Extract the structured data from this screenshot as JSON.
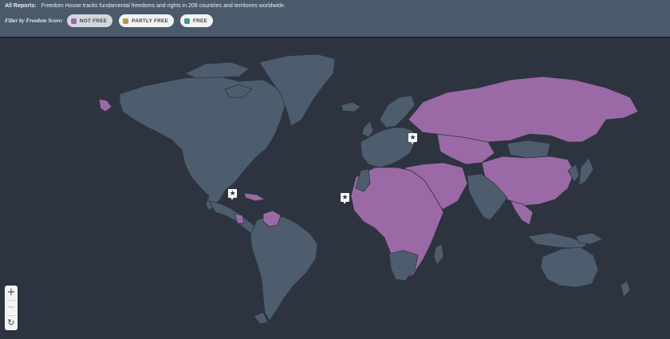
{
  "header": {
    "reports_label": "All Reports:",
    "reports_text": "Freedom House tracks fundamental freedoms and rights in 208 countries and territories worldwide.",
    "filter_label": "Filter by Freedom Score:",
    "filters": [
      {
        "label": "NOT FREE",
        "color": "#9b6aa6",
        "selected": true
      },
      {
        "label": "PARTLY FREE",
        "color": "#b8954f",
        "selected": false
      },
      {
        "label": "FREE",
        "color": "#3f9c86",
        "selected": false
      }
    ]
  },
  "map": {
    "land_color": "#4d5d6d",
    "not_free_color": "#9b6aa6",
    "water_color": "#2d3440",
    "markers": [
      {
        "name": "mexico-report-marker",
        "icon": "star-icon",
        "glyph": "★"
      },
      {
        "name": "west-africa-report-marker",
        "icon": "star-icon",
        "glyph": "★"
      },
      {
        "name": "eastern-europe-report-marker",
        "icon": "star-icon",
        "glyph": "★"
      }
    ]
  },
  "zoom": {
    "in": "+",
    "out": "−",
    "reset": "↻"
  }
}
